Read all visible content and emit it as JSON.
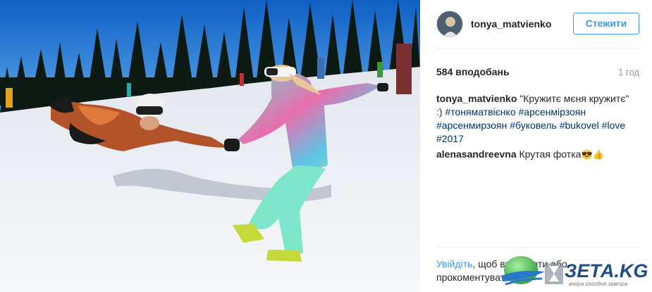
{
  "post": {
    "username": "tonya_matvienko",
    "follow_label": "Стежити",
    "likes": "584 вподобань",
    "time": "1 год",
    "caption_author": "tonya_matvienko",
    "caption_text": " \"Кружитє мєня кружитє\" :) ",
    "hashtags": [
      "#тоняматвієнко",
      "#арсенмірзоян",
      "#арсенмирзоян",
      "#буковель",
      "#bukovel",
      "#love",
      "#2017"
    ]
  },
  "comments": [
    {
      "author": "alenasandreevna",
      "text": " Крутая фотка",
      "emoji": "😎👍"
    }
  ],
  "login_prompt": {
    "link": "Увійдіть",
    "text": ", щоб вподобати або прокоментувати."
  },
  "watermark": {
    "brand": "ЗЕТА.KG",
    "tagline": "вчера сегодня завтра"
  },
  "colors": {
    "accent": "#3897f0",
    "hashtag": "#003569",
    "sky": "#1d6fd0",
    "snow": "#f2f4f6"
  },
  "icons": {
    "watermark": "globe-icon"
  }
}
